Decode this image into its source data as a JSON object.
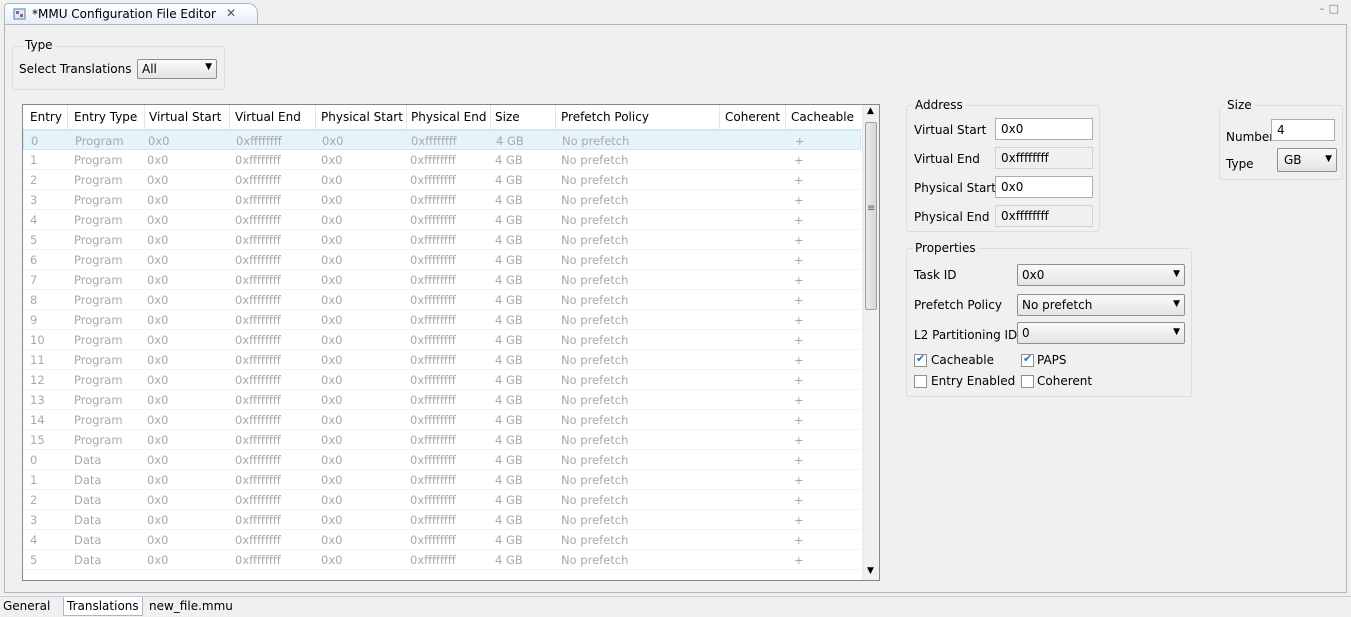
{
  "editor_tab": {
    "title": "*MMU Configuration File Editor",
    "close_glyph": "✕",
    "icon": "mmu-file-icon"
  },
  "window_buttons": {
    "minimize": "–",
    "maximize": "□"
  },
  "type_group": {
    "title": "Type",
    "select_label": "Select Translations",
    "select_value": "All"
  },
  "table": {
    "columns": [
      "Entry",
      "Entry Type",
      "Virtual Start",
      "Virtual End",
      "Physical Start",
      "Physical End",
      "Size",
      "Prefetch Policy",
      "Coherent",
      "Cacheable"
    ],
    "rows": [
      [
        "0",
        "Program",
        "0x0",
        "0xffffffff",
        "0x0",
        "0xffffffff",
        "4 GB",
        "No prefetch",
        "",
        "+"
      ],
      [
        "1",
        "Program",
        "0x0",
        "0xffffffff",
        "0x0",
        "0xffffffff",
        "4 GB",
        "No prefetch",
        "",
        "+"
      ],
      [
        "2",
        "Program",
        "0x0",
        "0xffffffff",
        "0x0",
        "0xffffffff",
        "4 GB",
        "No prefetch",
        "",
        "+"
      ],
      [
        "3",
        "Program",
        "0x0",
        "0xffffffff",
        "0x0",
        "0xffffffff",
        "4 GB",
        "No prefetch",
        "",
        "+"
      ],
      [
        "4",
        "Program",
        "0x0",
        "0xffffffff",
        "0x0",
        "0xffffffff",
        "4 GB",
        "No prefetch",
        "",
        "+"
      ],
      [
        "5",
        "Program",
        "0x0",
        "0xffffffff",
        "0x0",
        "0xffffffff",
        "4 GB",
        "No prefetch",
        "",
        "+"
      ],
      [
        "6",
        "Program",
        "0x0",
        "0xffffffff",
        "0x0",
        "0xffffffff",
        "4 GB",
        "No prefetch",
        "",
        "+"
      ],
      [
        "7",
        "Program",
        "0x0",
        "0xffffffff",
        "0x0",
        "0xffffffff",
        "4 GB",
        "No prefetch",
        "",
        "+"
      ],
      [
        "8",
        "Program",
        "0x0",
        "0xffffffff",
        "0x0",
        "0xffffffff",
        "4 GB",
        "No prefetch",
        "",
        "+"
      ],
      [
        "9",
        "Program",
        "0x0",
        "0xffffffff",
        "0x0",
        "0xffffffff",
        "4 GB",
        "No prefetch",
        "",
        "+"
      ],
      [
        "10",
        "Program",
        "0x0",
        "0xffffffff",
        "0x0",
        "0xffffffff",
        "4 GB",
        "No prefetch",
        "",
        "+"
      ],
      [
        "11",
        "Program",
        "0x0",
        "0xffffffff",
        "0x0",
        "0xffffffff",
        "4 GB",
        "No prefetch",
        "",
        "+"
      ],
      [
        "12",
        "Program",
        "0x0",
        "0xffffffff",
        "0x0",
        "0xffffffff",
        "4 GB",
        "No prefetch",
        "",
        "+"
      ],
      [
        "13",
        "Program",
        "0x0",
        "0xffffffff",
        "0x0",
        "0xffffffff",
        "4 GB",
        "No prefetch",
        "",
        "+"
      ],
      [
        "14",
        "Program",
        "0x0",
        "0xffffffff",
        "0x0",
        "0xffffffff",
        "4 GB",
        "No prefetch",
        "",
        "+"
      ],
      [
        "15",
        "Program",
        "0x0",
        "0xffffffff",
        "0x0",
        "0xffffffff",
        "4 GB",
        "No prefetch",
        "",
        "+"
      ],
      [
        "0",
        "Data",
        "0x0",
        "0xffffffff",
        "0x0",
        "0xffffffff",
        "4 GB",
        "No prefetch",
        "",
        "+"
      ],
      [
        "1",
        "Data",
        "0x0",
        "0xffffffff",
        "0x0",
        "0xffffffff",
        "4 GB",
        "No prefetch",
        "",
        "+"
      ],
      [
        "2",
        "Data",
        "0x0",
        "0xffffffff",
        "0x0",
        "0xffffffff",
        "4 GB",
        "No prefetch",
        "",
        "+"
      ],
      [
        "3",
        "Data",
        "0x0",
        "0xffffffff",
        "0x0",
        "0xffffffff",
        "4 GB",
        "No prefetch",
        "",
        "+"
      ],
      [
        "4",
        "Data",
        "0x0",
        "0xffffffff",
        "0x0",
        "0xffffffff",
        "4 GB",
        "No prefetch",
        "",
        "+"
      ],
      [
        "5",
        "Data",
        "0x0",
        "0xffffffff",
        "0x0",
        "0xffffffff",
        "4 GB",
        "No prefetch",
        "",
        "+"
      ]
    ],
    "selected_row": 0
  },
  "address_group": {
    "title": "Address",
    "virtual_start_label": "Virtual Start",
    "virtual_start_value": "0x0",
    "virtual_end_label": "Virtual End",
    "virtual_end_value": "0xffffffff",
    "physical_start_label": "Physical Start",
    "physical_start_value": "0x0",
    "physical_end_label": "Physical End",
    "physical_end_value": "0xffffffff"
  },
  "size_group": {
    "title": "Size",
    "number_label": "Number",
    "number_value": "4",
    "type_label": "Type",
    "type_value": "GB"
  },
  "properties_group": {
    "title": "Properties",
    "task_id_label": "Task ID",
    "task_id_value": "0x0",
    "prefetch_label": "Prefetch Policy",
    "prefetch_value": "No prefetch",
    "l2_label": "L2 Partitioning ID",
    "l2_value": "0",
    "cacheable_label": "Cacheable",
    "cacheable_checked": true,
    "paps_label": "PAPS",
    "paps_checked": true,
    "entry_enabled_label": "Entry Enabled",
    "entry_enabled_checked": false,
    "coherent_label": "Coherent",
    "coherent_checked": false
  },
  "bottom_tabs": [
    {
      "label": "General",
      "active": false
    },
    {
      "label": "Translations",
      "active": true
    },
    {
      "label": "new_file.mmu",
      "active": false
    }
  ],
  "icons": {
    "dropdown": "▼",
    "check": "✔",
    "scroll_up": "▲",
    "scroll_down": "▼",
    "grip": "≡"
  },
  "colors": {
    "selected_row": "#e5f3fb",
    "check_mark": "#2a6fc9",
    "disabled_text": "#a9a9a9"
  }
}
